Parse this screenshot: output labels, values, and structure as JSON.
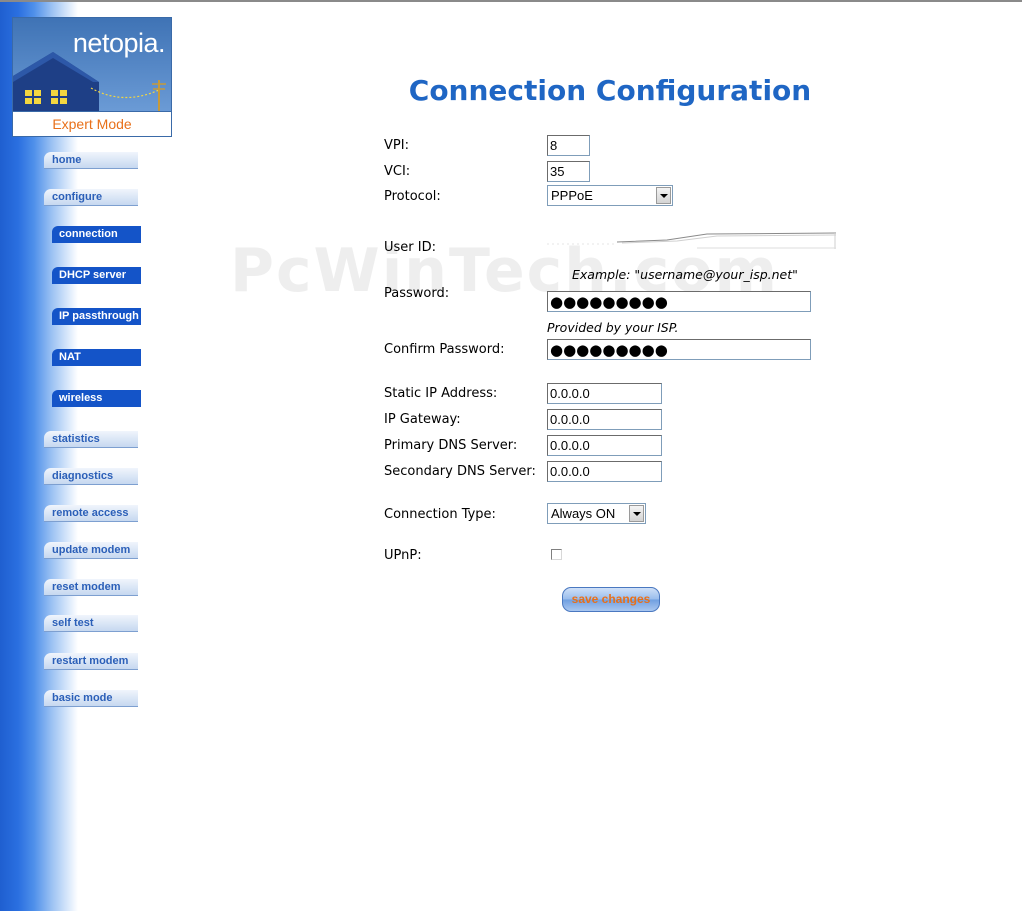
{
  "brand": {
    "logo_text": "netopia.",
    "mode_label": "Expert Mode"
  },
  "nav": {
    "items": [
      {
        "label": "home",
        "level": "main"
      },
      {
        "label": "configure",
        "level": "main"
      },
      {
        "label": "connection",
        "level": "sub"
      },
      {
        "label": "DHCP server",
        "level": "sub"
      },
      {
        "label": "IP passthrough",
        "level": "sub"
      },
      {
        "label": "NAT",
        "level": "sub"
      },
      {
        "label": "wireless",
        "level": "sub"
      },
      {
        "label": "statistics",
        "level": "main"
      },
      {
        "label": "diagnostics",
        "level": "main"
      },
      {
        "label": "remote access",
        "level": "main"
      },
      {
        "label": "update modem",
        "level": "main"
      },
      {
        "label": "reset modem",
        "level": "main"
      },
      {
        "label": "self test",
        "level": "main"
      },
      {
        "label": "restart modem",
        "level": "main"
      },
      {
        "label": "basic mode",
        "level": "main"
      }
    ]
  },
  "watermark": "PcWinTech.com",
  "page": {
    "title": "Connection Configuration"
  },
  "form": {
    "vpi": {
      "label": "VPI:",
      "value": "8"
    },
    "vci": {
      "label": "VCI:",
      "value": "35"
    },
    "protocol": {
      "label": "Protocol:",
      "value": "PPPoE"
    },
    "user_id": {
      "label": "User ID:",
      "value": "",
      "hint": "Example: \"username@your_isp.net\""
    },
    "password": {
      "label": "Password:",
      "value": "●●●●●●●●●",
      "hint": "Provided by your ISP."
    },
    "confirm_password": {
      "label": "Confirm Password:",
      "value": "●●●●●●●●●"
    },
    "static_ip": {
      "label": "Static IP Address:",
      "value": "0.0.0.0"
    },
    "ip_gateway": {
      "label": "IP Gateway:",
      "value": "0.0.0.0"
    },
    "primary_dns": {
      "label": "Primary DNS Server:",
      "value": "0.0.0.0"
    },
    "secondary_dns": {
      "label": "Secondary DNS Server:",
      "value": "0.0.0.0"
    },
    "connection_type": {
      "label": "Connection Type:",
      "value": "Always ON"
    },
    "upnp": {
      "label": "UPnP:",
      "checked": false
    },
    "save_label": "save changes"
  },
  "colors": {
    "title": "#1f66c4",
    "sidebar": "#1f5fd0",
    "accent_orange": "#e8701a",
    "nav_active": "#1454c8"
  }
}
